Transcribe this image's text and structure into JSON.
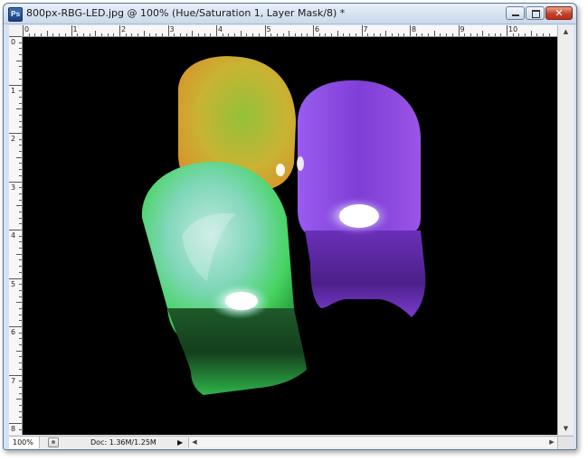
{
  "window": {
    "title": "800px-RBG-LED.jpg @ 100% (Hue/Saturation 1, Layer Mask/8) *",
    "app_icon_text": "Ps",
    "controls": {
      "close_glyph": "✕"
    }
  },
  "rulers": {
    "horizontal_labels": [
      "0",
      "1",
      "2",
      "3",
      "4",
      "5",
      "6",
      "7",
      "8",
      "9",
      "10"
    ],
    "vertical_labels": [
      "0",
      "1",
      "2",
      "3",
      "4",
      "5",
      "6",
      "7",
      "8"
    ],
    "unit": "inches"
  },
  "canvas": {
    "background": "#000000",
    "subject": [
      {
        "name": "yellow-led",
        "color": "#d6b030"
      },
      {
        "name": "purple-led",
        "color": "#8a45d9"
      },
      {
        "name": "green-led",
        "color": "#3fd35a"
      }
    ]
  },
  "status": {
    "zoom": "100%",
    "doc_info": "Doc: 1.36M/1.25M",
    "arrow": "▶"
  },
  "scrollbars": {
    "up_arrow": "▲",
    "down_arrow": "▼",
    "left_arrow": "◀",
    "right_arrow": "▶"
  }
}
